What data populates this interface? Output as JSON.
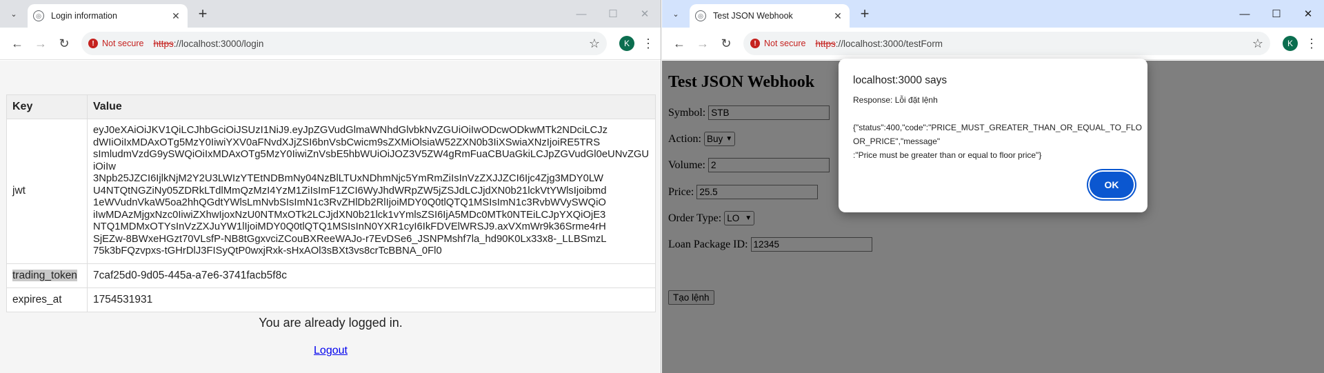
{
  "left": {
    "tab_title": "Login information",
    "url_scheme": "https",
    "url_rest": "://localhost:3000/login",
    "not_secure": "Not secure",
    "avatar_letter": "K",
    "table": {
      "headers": [
        "Key",
        "Value"
      ],
      "jwt_key": "jwt",
      "jwt_value": "eyJ0eXAiOiJKV1QiLCJhbGciOiJSUzI1NiJ9.eyJpZGVudGlmaWNhdGlvbkNvZGUiOiIwODcwODkwMTk2NDciLCJzdWIiOiIxMDAxOTg5MzY0IiwiYXV0aFNvdXJjZSI6bnVsbCwicm9sZXMiOlsiaW52ZXN0b3IiXSwiaXNzIjoiRE5TRSIsImludmVzdG9ySWQiOiIxMDAxOTg5MzY0IiwiZnVsbE5hbWUiOiJOZ3V5ZW4gRmFuaCBUaGkiLCJpZGVudGl0eUNvZGUiOiIwNDg3NDIyODAyIiwiaWF0IjoxNjgyNjA0MzQyLCJ1c2VySWQiOiIxMzkxNDYzMCIsImV4cCI6MTY4MjY4OTk0MiwiYWNjb3VudE51bWJlciI6IjAzOHQ2ODMxMDMiLCJ0cmFkaW5nQWNjb3VudE51bWJlciI6IjAzOFQ2ODMxMDMiLCJjdXN0b21lcklkIjoiMDMzMTEyMzQ2MDYiLCJ0eXBlIjoiSU5ESVZJRFVBTCJ9.axVXmWr9k36Srme4rHSjEZw-8BWxeHGzt70VLsfP-NB8tGgxvciZCouBXReeWAJo-r7EvDSe6_JSNPMshf7la_hd90K0Lx33x8-_LLBSmzL75k3bFQzvpxs-tGHrDlJ3FISyQtP0wxjRxk-sHxAOl3sBXt3vs8crTcBBNA_0Fl0",
      "jwt_lines": [
        "eyJ0eXAiOiJKV1QiLCJhbGciOiJSUzI1NiJ9.eyJpZGVudGlmaWNhdGlvbkNvZGUiOiIwODcwODkwMTk2NDciLCJz",
        "dWIiOiIxMDAxOTg5MzY0IiwiYXV0aFNvdXJjZSI6bnVsbCwicm9sZXMiOlsiaW52ZXN0b3IiXSwiaXNzIjoiRE5TRS",
        "sImludmVzdG9ySWQiOiIxMDAxOTg5MzY0IiwiZnVsbE5hbWUiOiJOZ3V5ZW4gRmFuaCBUaGkiLCJpZGVudGl0eUNvZGUiOiIw",
        "3Npb25JZCI6IjlkNjM2Y2U3LWIzYTEtNDBmNy04NzBlLTUxNDhmNjc5YmRmZiIsInVzZXJJZCI6Ijc4Zjg3MDY0LW",
        "U4NTQtNGZiNy05ZDRkLTdlMmQzMzI4YzM1ZiIsImF1ZCI6WyJhdWRpZW5jZSJdLCJjdXN0b21lckVtYWlsIjoibmd",
        "1eWVudnVkaW5oa2hhQGdtYWlsLmNvbSIsImN1c3RvZHlDb2RlIjoiMDY0Q0tlQTQ1MSIsImN1c3RvbWVySWQiO",
        "iIwMDAzMjgxNzc0IiwiZXhwIjoxNzU0NTMxOTk2LCJjdXN0b21lck1vYmlsZSI6IjA5MDc0MTk0NTEiLCJpYXQiOjE3",
        "NTQ1MDMxOTYsInVzZXJuYW1lIjoiMDY0Q0tlQTQ1MSIsInN0YXR1cyI6IkFDVElWRSJ9.axVXmWr9k36Srme4rH",
        "SjEZw-8BWxeHGzt70VLsfP-NB8tGgxvciZCouBXReeWAJo-r7EvDSe6_JSNPMshf7la_hd90K0Lx33x8-_LLBSmzL",
        "75k3bFQzvpxs-tGHrDlJ3FISyQtP0wxjRxk-sHxAOl3sBXt3vs8crTcBBNA_0Fl0"
      ],
      "trading_token_key": "trading_token",
      "trading_token_value": "7caf25d0-9d05-445a-a7e6-3741facb5f8c",
      "expires_key": "expires_at",
      "expires_value": "1754531931"
    },
    "logged_in_text": "You are already logged in.",
    "logout_label": "Logout"
  },
  "right": {
    "tab_title": "Test JSON Webhook",
    "url_scheme": "https",
    "url_rest": "://localhost:3000/testForm",
    "not_secure": "Not secure",
    "avatar_letter": "K",
    "form": {
      "title": "Test JSON Webhook",
      "symbol_label": "Symbol:",
      "symbol_value": "STB",
      "action_label": "Action:",
      "action_value": "Buy",
      "volume_label": "Volume:",
      "volume_value": "2",
      "price_label": "Price:",
      "price_value": "25.5",
      "order_type_label": "Order Type:",
      "order_type_value": "LO",
      "loan_label": "Loan Package ID:",
      "loan_value": "12345",
      "submit_label": "Tạo lệnh"
    },
    "dialog": {
      "title": "localhost:3000 says",
      "response": "Response: Lỗi đặt lệnh",
      "line1": "{\"status\":400,\"code\":\"PRICE_MUST_GREATER_THAN_OR_EQUAL_TO_FLO",
      "line2": "OR_PRICE\",\"message\"",
      "line3": ":\"Price must be greater than or equal to floor price\"}",
      "ok_label": "OK"
    }
  },
  "colors": {
    "not_secure_red": "#c5221f",
    "ok_blue": "#0b57d0",
    "link_blue": "#0000ee",
    "avatar_green": "#0b6e4f"
  }
}
